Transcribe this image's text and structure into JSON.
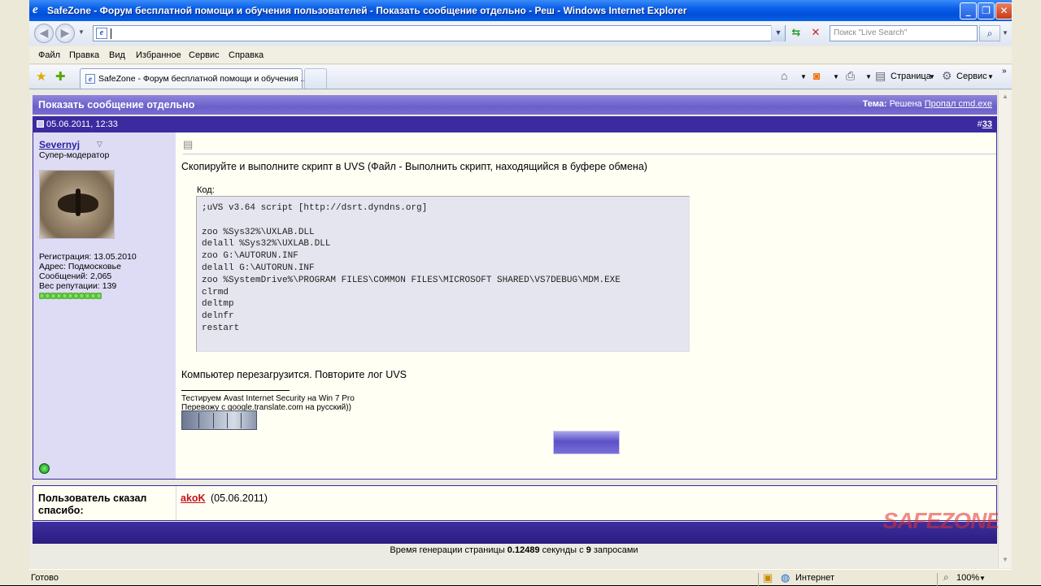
{
  "window": {
    "title": "SafeZone - Форум бесплатной помощи и обучения пользователей - Показать сообщение отдельно - Реш - Windows Internet Explorer"
  },
  "address": {
    "value": ""
  },
  "search": {
    "placeholder": "Поиск \"Live Search\""
  },
  "menu": [
    "Файл",
    "Правка",
    "Вид",
    "Избранное",
    "Сервис",
    "Справка"
  ],
  "tab": {
    "label": "SafeZone - Форум бесплатной помощи и обучения ..."
  },
  "commands": {
    "page": "Страница",
    "tools": "Сервис"
  },
  "post": {
    "header_title": "Показать сообщение отдельно",
    "thread_prefix": "Тема:",
    "thread_status": "Решена",
    "thread_name": "Пропал cmd.exe",
    "date": "05.06.2011, 12:33",
    "number_prefix": "#",
    "number": "33"
  },
  "user": {
    "name": "Severnyj",
    "title": "Супер-модератор",
    "registration": "Регистрация: 13.05.2010",
    "location": "Адрес: Подмосковье",
    "posts": "Сообщений: 2,065",
    "reputation": "Вес репутации: 139",
    "reputation_dots": 11
  },
  "message": {
    "intro": "Скопируйте и выполните скрипт в UVS (Файл - Выполнить скрипт, находящийся в буфере обмена)",
    "code_label": "Код:",
    "code_lines": [
      ";uVS v3.64 script [http://dsrt.dyndns.org]",
      "",
      "zoo %Sys32%\\UXLAB.DLL",
      "delall %Sys32%\\UXLAB.DLL",
      "zoo G:\\AUTORUN.INF",
      "delall G:\\AUTORUN.INF",
      "zoo %SystemDrive%\\PROGRAM FILES\\COMMON FILES\\MICROSOFT SHARED\\VS7DEBUG\\MDM.EXE",
      "clrmd",
      "deltmp",
      "delnfr",
      "restart"
    ],
    "after": "Компьютер перезагрузится. Повторите лог UVS",
    "signature_line1": "Тестируем Avast Internet Security на Win 7 Pro",
    "signature_line2": "Перевожу с google.translate.com на русский))"
  },
  "thanks": {
    "label": "Пользователь сказал спасибо:",
    "user": "akoK",
    "date": "(05.06.2011)"
  },
  "logo_text": "SAFEZONE",
  "footer": {
    "prefix": "Время генерации страницы",
    "seconds": "0.12489",
    "middle": "секунды с",
    "queries": "9",
    "suffix": "запросами"
  },
  "status": {
    "left": "Готово",
    "zone": "Интернет",
    "zoom": "100%"
  }
}
